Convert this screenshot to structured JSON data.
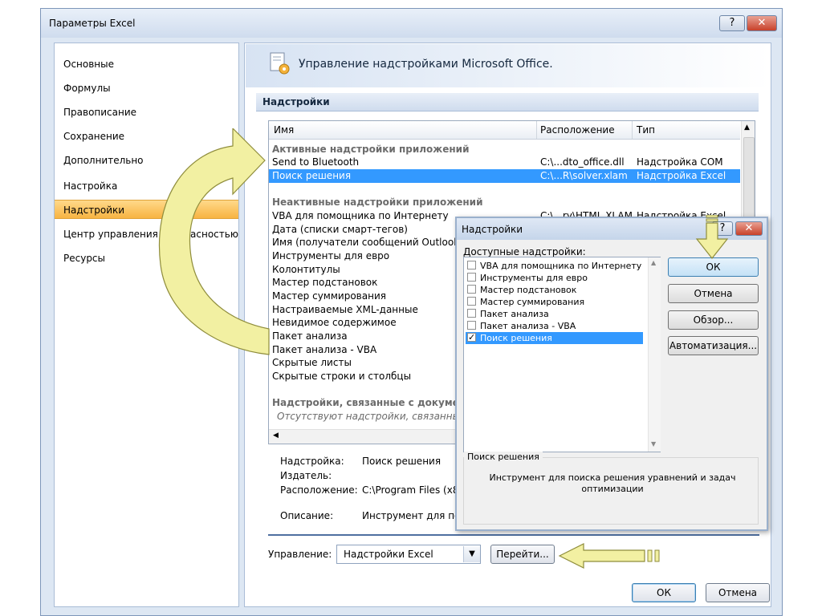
{
  "window": {
    "title": "Параметры Excel",
    "help": "?",
    "close": "✕"
  },
  "nav": {
    "items": [
      "Основные",
      "Формулы",
      "Правописание",
      "Сохранение",
      "Дополнительно",
      "Настройка",
      "Надстройки",
      "Центр управления безопасностью",
      "Ресурсы"
    ],
    "active": 6
  },
  "header": {
    "title": "Управление надстройками Microsoft Office.",
    "icon": "addins-gear-icon"
  },
  "section": {
    "label": "Надстройки"
  },
  "list": {
    "columns": [
      "Имя",
      "Расположение",
      "Тип"
    ],
    "group_active": "Активные надстройки приложений",
    "active_items": [
      {
        "name": "Send to Bluetooth",
        "location": "C:\\...dto_office.dll",
        "type": "Надстройка COM"
      },
      {
        "name": "Поиск решения",
        "location": "C:\\...R\\solver.xlam",
        "type": "Надстройка Excel"
      }
    ],
    "group_inactive": "Неактивные надстройки приложений",
    "inactive_items": [
      {
        "name": "VBA для помощника по Интернету",
        "location": "C:\\...ry\\HTML.XLAM",
        "type": "Надстройка Excel"
      },
      {
        "name": "Дата (списки смарт-тегов)",
        "location": "",
        "type": ""
      },
      {
        "name": "Имя (получатели сообщений Outlook)",
        "location": "",
        "type": ""
      },
      {
        "name": "Инструменты для евро",
        "location": "",
        "type": ""
      },
      {
        "name": "Колонтитулы",
        "location": "",
        "type": ""
      },
      {
        "name": "Мастер подстановок",
        "location": "",
        "type": ""
      },
      {
        "name": "Мастер суммирования",
        "location": "",
        "type": ""
      },
      {
        "name": "Настраиваемые XML-данные",
        "location": "",
        "type": ""
      },
      {
        "name": "Невидимое содержимое",
        "location": "",
        "type": ""
      },
      {
        "name": "Пакет анализа",
        "location": "",
        "type": ""
      },
      {
        "name": "Пакет анализа - VBA",
        "location": "",
        "type": ""
      },
      {
        "name": "Скрытые листы",
        "location": "",
        "type": ""
      },
      {
        "name": "Скрытые строки и столбцы",
        "location": "",
        "type": ""
      }
    ],
    "group_docs": "Надстройки, связанные с документами",
    "docs_note": "Отсутствуют надстройки, связанные"
  },
  "details": {
    "addin_label": "Надстройка:",
    "addin_value": "Поиск решения",
    "publisher_label": "Издатель:",
    "location_label": "Расположение:",
    "location_value": "C:\\Program Files (x86",
    "description_label": "Описание:",
    "description_value": "Инструмент для пои"
  },
  "manage": {
    "label": "Управление:",
    "value": "Надстройки Excel",
    "go": "Перейти..."
  },
  "footer": {
    "ok": "ОК",
    "cancel": "Отмена"
  },
  "dialog": {
    "title": "Надстройки",
    "help": "?",
    "close": "✕",
    "available_label": "Доступные надстройки:",
    "items": [
      {
        "label": "VBA для помощника по Интернету",
        "checked": false
      },
      {
        "label": "Инструменты для евро",
        "checked": false
      },
      {
        "label": "Мастер подстановок",
        "checked": false
      },
      {
        "label": "Мастер суммирования",
        "checked": false
      },
      {
        "label": "Пакет анализа",
        "checked": false
      },
      {
        "label": "Пакет анализа - VBA",
        "checked": false
      },
      {
        "label": "Поиск решения",
        "checked": true
      }
    ],
    "ok": "ОК",
    "cancel": "Отмена",
    "browse": "Обзор...",
    "automation": "Автоматизация...",
    "desc_title": "Поиск решения",
    "desc_text": "Инструмент для поиска решения уравнений и задач оптимизации"
  },
  "colors": {
    "accent": "#3399ff",
    "nav_active": "#f7b342",
    "arrow_fill": "#f2f0a2"
  }
}
